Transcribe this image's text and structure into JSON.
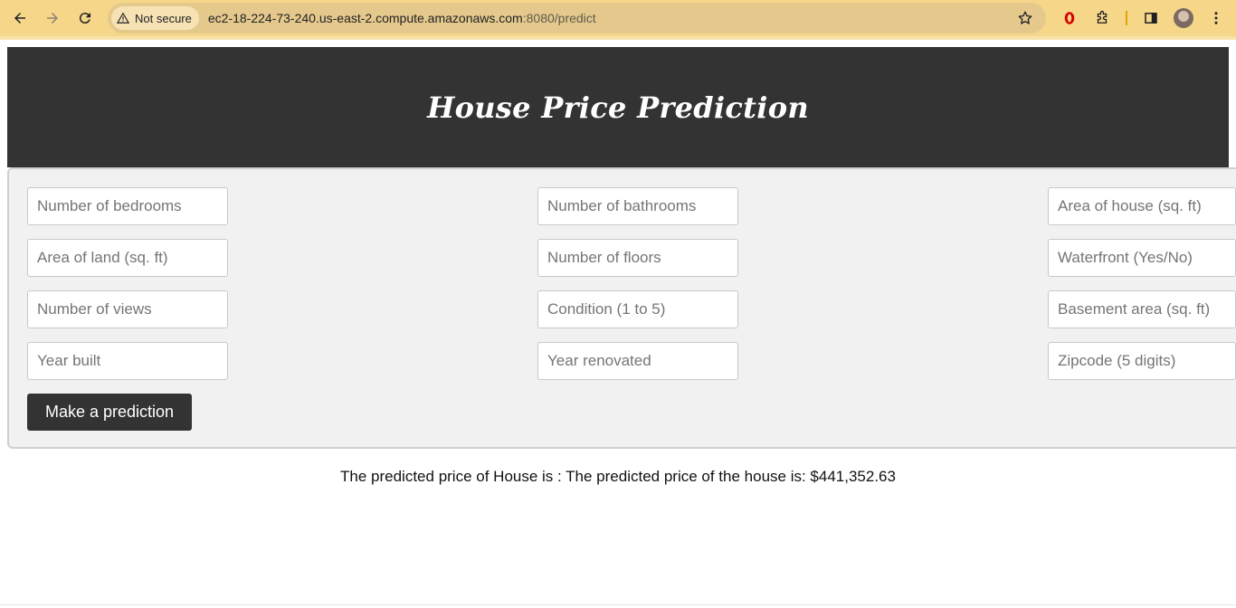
{
  "browser": {
    "security_label": "Not secure",
    "url_host": "ec2-18-224-73-240.us-east-2.compute.amazonaws.com",
    "url_path": ":8080/predict"
  },
  "page": {
    "title": "House Price Prediction"
  },
  "form": {
    "fields": {
      "bedrooms": "Number of bedrooms",
      "bathrooms": "Number of bathrooms",
      "area_house": "Area of house (sq. ft)",
      "area_land": "Area of land (sq. ft)",
      "floors": "Number of floors",
      "waterfront": "Waterfront (Yes/No)",
      "views": "Number of views",
      "condition": "Condition (1 to 5)",
      "basement": "Basement area (sq. ft)",
      "year_built": "Year built",
      "year_renovated": "Year renovated",
      "zipcode": "Zipcode (5 digits)"
    },
    "submit_label": "Make a prediction"
  },
  "result": {
    "text": "The predicted price of House is : The predicted price of the house is: $441,352.63"
  }
}
